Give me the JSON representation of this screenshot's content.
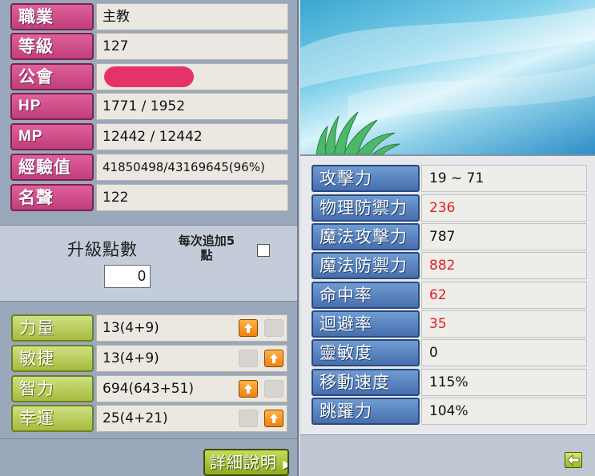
{
  "character_info": {
    "job": {
      "label": "職業",
      "value": "主教"
    },
    "level": {
      "label": "等級",
      "value": "127"
    },
    "guild": {
      "label": "公會",
      "value": ""
    },
    "hp": {
      "label": "HP",
      "value": "1771 / 1952"
    },
    "mp": {
      "label": "MP",
      "value": "12442 / 12442"
    },
    "exp": {
      "label": "經驗值",
      "value": "41850498/43169645(96%)"
    },
    "fame": {
      "label": "名聲",
      "value": "122"
    }
  },
  "ability_points": {
    "title": "升級點數",
    "value": "0",
    "auto_add_line1": "每次追加5",
    "auto_add_line2": "點",
    "auto_add_checked": false
  },
  "stats": [
    {
      "label": "力量",
      "value": "13(4+9)",
      "up_enabled": true
    },
    {
      "label": "敏捷",
      "value": "13(4+9)",
      "up_enabled": true
    },
    {
      "label": "智力",
      "value": "694(643+51)",
      "up_enabled": true
    },
    {
      "label": "幸運",
      "value": "25(4+21)",
      "up_enabled": true
    }
  ],
  "details_button": {
    "label": "詳細說明"
  },
  "combat_stats": [
    {
      "label": "攻擊力",
      "value": "19 ~ 71",
      "highlight": false
    },
    {
      "label": "物理防禦力",
      "value": "236",
      "highlight": true
    },
    {
      "label": "魔法攻擊力",
      "value": "787",
      "highlight": false
    },
    {
      "label": "魔法防禦力",
      "value": "882",
      "highlight": true
    },
    {
      "label": "命中率",
      "value": "62",
      "highlight": true
    },
    {
      "label": "迴避率",
      "value": "35",
      "highlight": true
    },
    {
      "label": "靈敏度",
      "value": "0",
      "highlight": false
    },
    {
      "label": "移動速度",
      "value": "115%",
      "highlight": false
    },
    {
      "label": "跳躍力",
      "value": "104%",
      "highlight": false
    }
  ],
  "colors": {
    "info_label": "#d04e8c",
    "stat_label": "#b8cc55",
    "combat_label": "#5a84c2",
    "highlight_value": "#e02020"
  },
  "icons": {
    "stat_up": "arrow-up-icon",
    "back": "arrow-left-icon"
  }
}
